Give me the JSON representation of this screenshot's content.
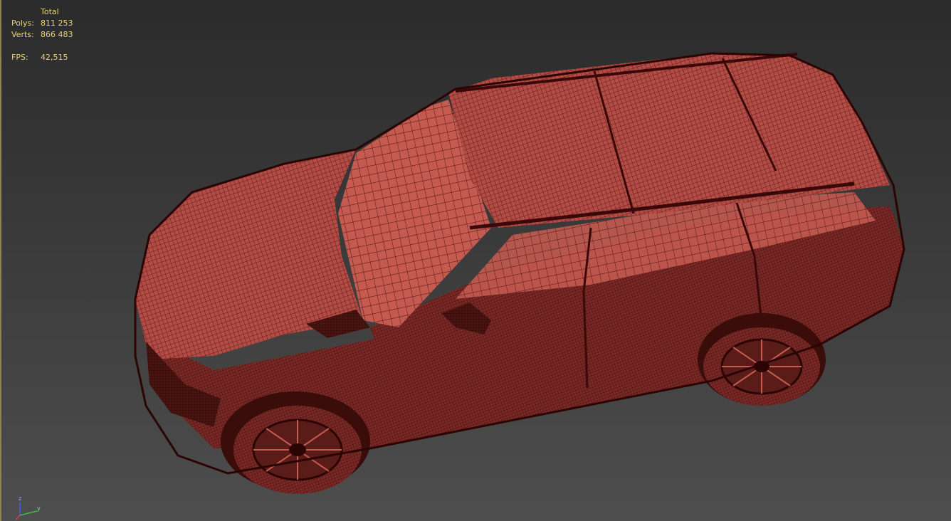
{
  "stats": {
    "header": "Total",
    "polys_label": "Polys:",
    "polys_value": "811 253",
    "verts_label": "Verts:",
    "verts_value": "866 483",
    "fps_label": "FPS:",
    "fps_value": "42,515"
  },
  "gizmo": {
    "z_label": "z",
    "y_label": "y",
    "x_color": "#e04040",
    "y_color": "#40c040",
    "z_color": "#4060ff"
  },
  "colors": {
    "stats_text": "#e8d27a",
    "mesh_fill": "#b8524a",
    "mesh_wire": "#4a1010",
    "active_border": "#8a8a3a"
  },
  "model": {
    "name_icon": "suv-wireframe-mesh"
  }
}
